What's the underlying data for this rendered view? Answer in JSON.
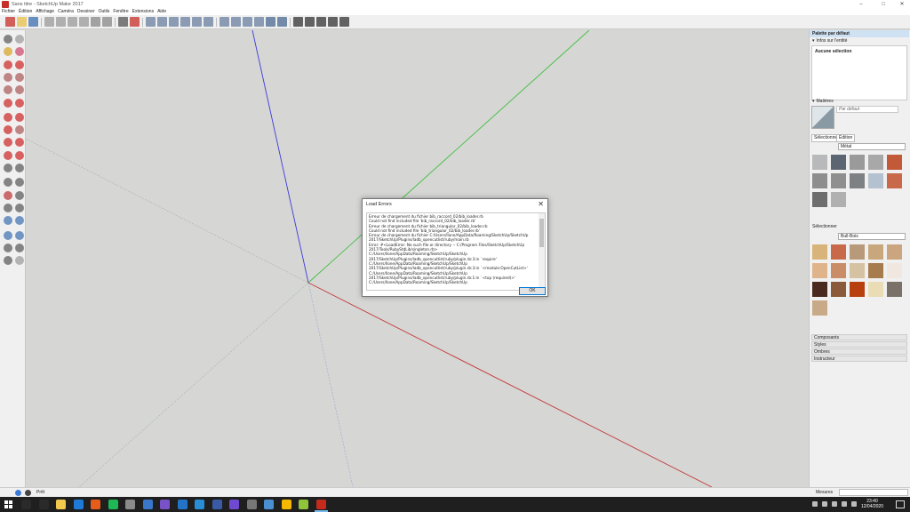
{
  "window": {
    "title": "Sans titre - SketchUp Make 2017",
    "minimize": "–",
    "maximize": "□",
    "close": "✕"
  },
  "menu": [
    "Fichier",
    "Édition",
    "Affichage",
    "Caméra",
    "Dessiner",
    "Outils",
    "Fenêtre",
    "Extensions",
    "Aide"
  ],
  "toolbar_icons": [
    "new-icon",
    "open-icon",
    "save-icon",
    "cut-icon",
    "copy-icon",
    "paste-icon",
    "erase-icon",
    "undo-icon",
    "redo-icon",
    "print-icon",
    "model-info-icon",
    "iso-view-icon",
    "top-view-icon",
    "front-view-icon",
    "right-view-icon",
    "back-view-icon",
    "left-view-icon",
    "xray-icon",
    "wireframe-icon",
    "hidden-line-icon",
    "shaded-icon",
    "textured-icon",
    "monochrome-icon",
    "warehouse-icon",
    "share-icon",
    "home-icon",
    "extension-icon",
    "layer-icon"
  ],
  "left_tools": [
    "select-icon",
    "make-component-icon",
    "paint-bucket-icon",
    "eraser-icon",
    "line-icon",
    "freehand-icon",
    "rectangle-icon",
    "rotated-rectangle-icon",
    "circle-icon",
    "polygon-icon",
    "arc-icon",
    "two-point-arc-icon",
    "pie-icon",
    "three-point-arc-icon",
    "move-icon",
    "push-pull-icon",
    "rotate-icon",
    "follow-me-icon",
    "scale-icon",
    "offset-icon",
    "tape-measure-icon",
    "dimension-icon",
    "protractor-icon",
    "text-icon",
    "axes-icon",
    "3d-text-icon",
    "orbit-icon",
    "pan-icon",
    "zoom-icon",
    "zoom-window-icon",
    "zoom-extents-icon",
    "previous-view-icon",
    "position-camera-icon",
    "look-around-icon",
    "walk-icon",
    "section-plane-icon"
  ],
  "dialog": {
    "title": "Load Errors",
    "close": "✕",
    "lines": [
      "Erreur de chargement du fichier bib_raccord_02/bib_loader.rb",
      "Could not find included file 'bib_raccord_02/bib_loader.rb'",
      "Erreur de chargement du fichier bib_triangulor_02/bib_loader.rb",
      "Could not find included file 'bib_triangulor_02/bib_loader.rb'",
      "Erreur de chargement du fichier C:/Users/llone/AppData/Roaming/SketchUp/SketchUp",
      "2017/SketchUp/Plugins/ladb_opencutlist/ruby/main.rb",
      "Error: #<LoadError: No such file or directory -- C:/Program Files/SketchUp/SketchUp",
      "2017/Tools/RubyStdLib/singleton.rb>",
      "C:/Users/llone/AppData/Roaming/SketchUp/SketchUp",
      "2017/SketchUp/Plugins/ladb_opencutlist/ruby/plugin.rb:3:in `require'",
      "C:/Users/llone/AppData/Roaming/SketchUp/SketchUp",
      "2017/SketchUp/Plugins/ladb_opencutlist/ruby/plugin.rb:3:in `<module:OpenCutList>'",
      "C:/Users/llone/AppData/Roaming/SketchUp/SketchUp",
      "2017/SketchUp/Plugins/ladb_opencutlist/ruby/plugin.rb:1:in `<top (required)>'",
      "C:/Users/llone/AppData/Roaming/SketchUp/SketchUp"
    ],
    "ok": "OK"
  },
  "panel": {
    "tray_title": "Palette par défaut",
    "entity_header": "Infos sur l'entité",
    "entity_value": "Aucune sélection",
    "materials_header": "Matières",
    "material_name": "Par défaut",
    "tab_select": "Sélectionner",
    "tab_edit": "Édition",
    "library1": "Métal",
    "library2_label": "Sélectionner",
    "library2": "Bull-Bois",
    "metal_swatches": [
      "#b7b9bb",
      "#5c6672",
      "#9a9a9a",
      "#a8a8a8",
      "#c25a3a",
      "#8e8e8e",
      "#8f8f8f",
      "#7e8184",
      "#b4c2d0",
      "#c8694a",
      "#6e6e6e",
      "#b0b0b0"
    ],
    "wood_swatches": [
      "#d9b47a",
      "#c86a4a",
      "#b89a7a",
      "#c9a77d",
      "#cba580",
      "#e0b48a",
      "#c98e68",
      "#d5c2a2",
      "#a67c4e",
      "#f0e8e0",
      "#4a2a1e",
      "#8a5a3a",
      "#b8400e",
      "#eadcb4",
      "#7a7268",
      "#c8aa88"
    ],
    "collapsed": [
      "Composants",
      "Styles",
      "Ombres",
      "Instructeur"
    ]
  },
  "status": {
    "text": "Prêt",
    "measures": "Mesures"
  },
  "taskbar": {
    "time": "23:40",
    "date": "12/04/2020",
    "apps": [
      "#2a2a2a",
      "#2a2a2a",
      "#f2c94c",
      "#1e7ad6",
      "#e65c1b",
      "#1db954",
      "#8b8b8b",
      "#3a76c9",
      "#7a52c7",
      "#2374c6",
      "#2a8ed6",
      "#3a5aa5",
      "#6f4ad0",
      "#777777",
      "#4a90d0",
      "#f5b800",
      "#8fc43a",
      "#c42b1c"
    ]
  },
  "colors": {
    "axis_blue": "#3a3ae0",
    "axis_green": "#3fbf3f",
    "axis_red": "#c23a3a",
    "accent": "#0078d7"
  }
}
